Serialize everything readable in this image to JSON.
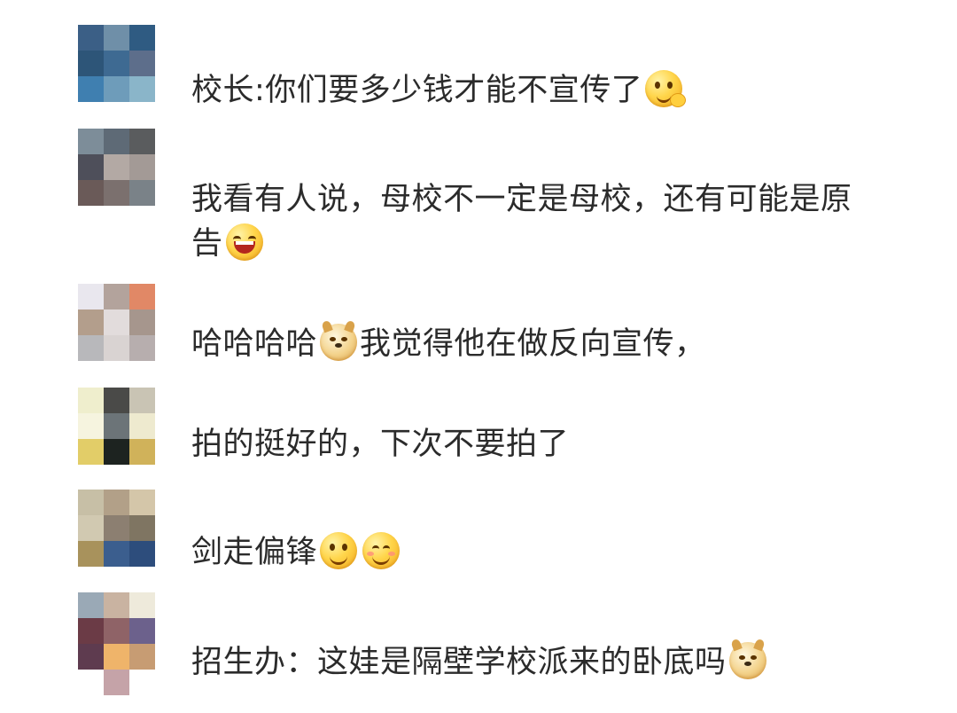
{
  "comments": [
    {
      "avatar": [
        "#3b5f86",
        "#6f8fa8",
        "#2f5b82",
        "#2d5578",
        "#3e6a92",
        "#5d6e8b",
        "#3f7fb0",
        "#6e9cba",
        "#8ab5c9"
      ],
      "segments": [
        {
          "t": "text",
          "v": "校长:你们要多少钱才能不宣传了"
        },
        {
          "t": "emoji",
          "icon": "drooling-face-icon"
        }
      ]
    },
    {
      "avatar": [
        "#7d8d99",
        "#5e6a76",
        "#5a5c5e",
        "#4e4f5a",
        "#b3a9a4",
        "#a39a96",
        "#6a5a58",
        "#7b706e",
        "#7a8288"
      ],
      "segments": [
        {
          "t": "text",
          "v": "我看有人说，母校不一定是母校，还有可能是原告"
        },
        {
          "t": "emoji",
          "icon": "laughing-face-icon"
        }
      ]
    },
    {
      "avatar": [
        "#e9e7ee",
        "#b3a39c",
        "#e18866",
        "#b39e8c",
        "#e2dcdc",
        "#a6968d",
        "#b8b8bb",
        "#d9d3d2",
        "#b7aeae"
      ],
      "segments": [
        {
          "t": "text",
          "v": "哈哈哈哈"
        },
        {
          "t": "emoji",
          "icon": "doge-icon"
        },
        {
          "t": "text",
          "v": "我觉得他在做反向宣传，"
        }
      ]
    },
    {
      "avatar": [
        "#efeecd",
        "#4a4a48",
        "#c9c4b4",
        "#f6f4df",
        "#6c7478",
        "#eeeacf",
        "#e2cd68",
        "#1d2320",
        "#d0b25a"
      ],
      "segments": [
        {
          "t": "text",
          "v": "拍的挺好的，下次不要拍了"
        }
      ]
    },
    {
      "avatar": [
        "#c7bfa6",
        "#b2a088",
        "#d4c6a9",
        "#d1c9b1",
        "#8c7f71",
        "#7f7562",
        "#a8925c",
        "#3b5e8e",
        "#2d4d7c"
      ],
      "segments": [
        {
          "t": "text",
          "v": "剑走偏锋"
        },
        {
          "t": "emoji",
          "icon": "smiling-face-icon"
        },
        {
          "t": "emoji",
          "icon": "blushing-face-icon"
        }
      ]
    },
    {
      "avatar": [
        "#9aa9b6",
        "#c9b3a1",
        "#eeeadb",
        "#6b3b46",
        "#8f6367",
        "#6c618c",
        "#5e3b4f",
        "#efb46a",
        "#c79c73",
        "#ffffff",
        "#c5a3a8",
        "#ffffff"
      ],
      "segments": [
        {
          "t": "text",
          "v": "招生办：这娃是隔壁学校派来的卧底吗"
        },
        {
          "t": "emoji",
          "icon": "doge-icon"
        }
      ]
    }
  ]
}
